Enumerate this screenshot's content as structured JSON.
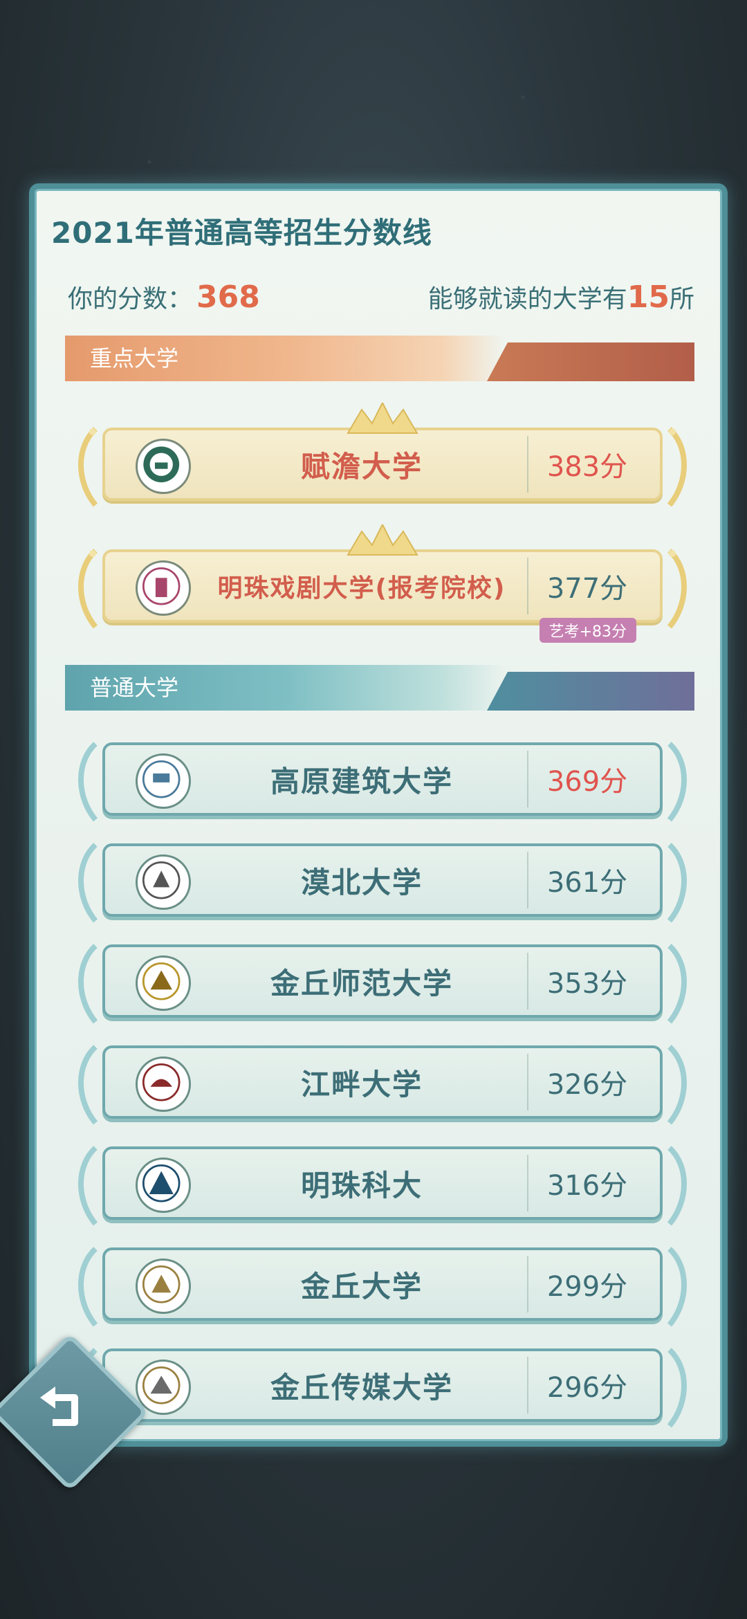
{
  "panel": {
    "title": "2021年普通高等招生分数线",
    "your_score_label": "你的分数：",
    "your_score": "368",
    "eligible_prefix": "能够就读的大学有",
    "eligible_count": "15",
    "eligible_suffix": "所"
  },
  "sections": {
    "key_label": "重点大学",
    "normal_label": "普通大学"
  },
  "key_universities": [
    {
      "name": "赋澹大学",
      "score": "383分",
      "logo_icon": "university-seal-icon"
    },
    {
      "name": "明珠戏剧大学(报考院校)",
      "score": "377分",
      "badge": "艺考+83分",
      "logo_icon": "drama-university-seal-icon"
    }
  ],
  "normal_universities": [
    {
      "name": "高原建筑大学",
      "score": "369分",
      "score_color": "#e0544e",
      "logo_icon": "architecture-seal-icon"
    },
    {
      "name": "漠北大学",
      "score": "361分",
      "logo_icon": "university-seal-icon"
    },
    {
      "name": "金丘师范大学",
      "score": "353分",
      "logo_icon": "normal-university-seal-icon"
    },
    {
      "name": "江畔大学",
      "score": "326分",
      "logo_icon": "university-seal-icon"
    },
    {
      "name": "明珠科大",
      "score": "316分",
      "logo_icon": "science-university-seal-icon"
    },
    {
      "name": "金丘大学",
      "score": "299分",
      "logo_icon": "university-seal-icon"
    },
    {
      "name": "金丘传媒大学",
      "score": "296分",
      "logo_icon": "media-university-seal-icon"
    }
  ],
  "controls": {
    "back_icon": "back-arrow-icon"
  }
}
